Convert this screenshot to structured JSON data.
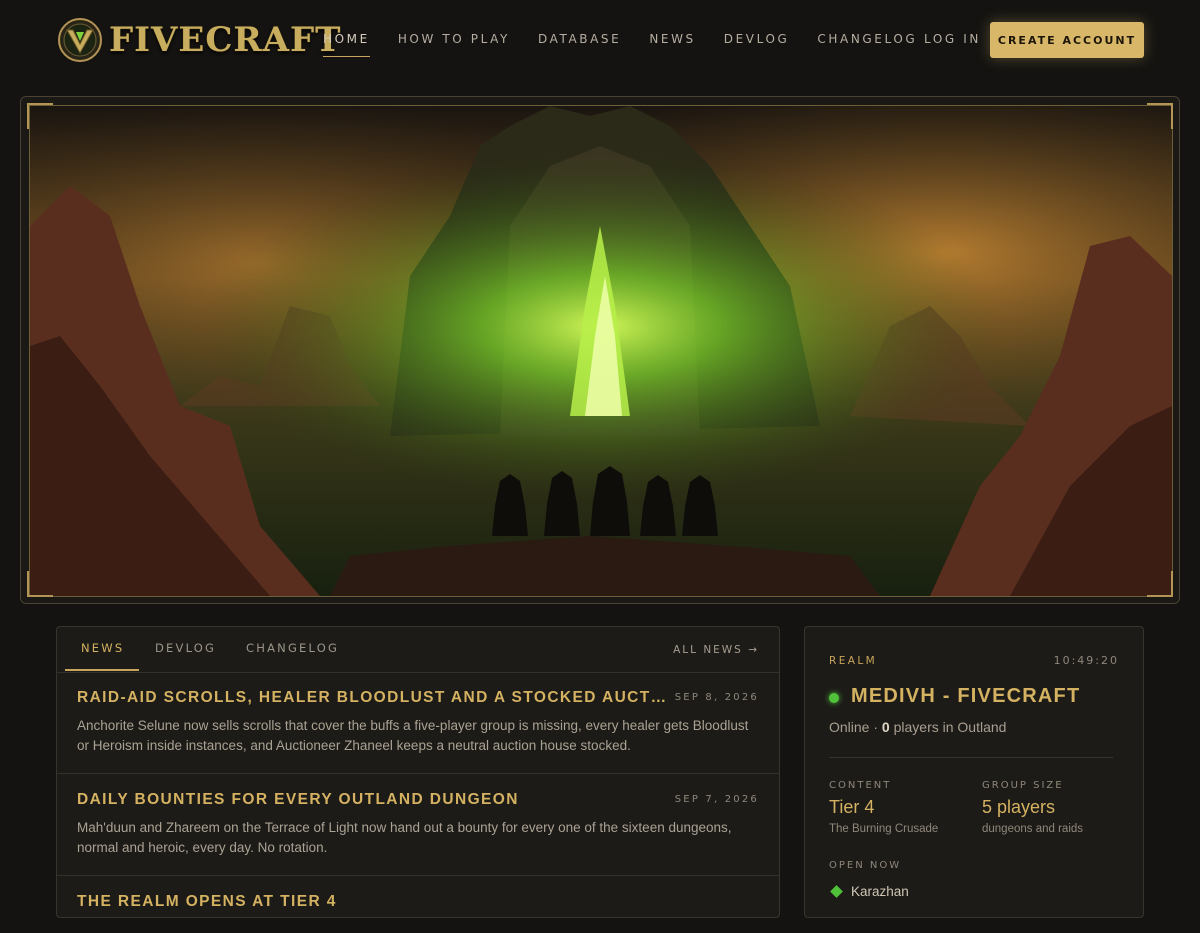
{
  "brand": {
    "name": "FIVECRAFT"
  },
  "nav": {
    "items": [
      {
        "label": "HOME",
        "active": true
      },
      {
        "label": "HOW TO PLAY"
      },
      {
        "label": "DATABASE"
      },
      {
        "label": "NEWS"
      },
      {
        "label": "DEVLOG"
      },
      {
        "label": "CHANGELOG"
      }
    ],
    "login": "LOG IN",
    "create_account": "CREATE ACCOUNT"
  },
  "news": {
    "tabs": [
      {
        "label": "NEWS",
        "active": true
      },
      {
        "label": "DEVLOG"
      },
      {
        "label": "CHANGELOG"
      }
    ],
    "all_news": "ALL NEWS →",
    "articles": [
      {
        "title": "RAID-AID SCROLLS, HEALER BLOODLUST AND A STOCKED AUCTION HOUSE",
        "date": "SEP 8, 2026",
        "body": "Anchorite Selune now sells scrolls that cover the buffs a five-player group is missing, every healer gets Bloodlust or Heroism inside instances, and Auctioneer Zhaneel keeps a neutral auction house stocked."
      },
      {
        "title": "DAILY BOUNTIES FOR EVERY OUTLAND DUNGEON",
        "date": "SEP 7, 2026",
        "body": "Mah'duun and Zhareem on the Terrace of Light now hand out a bounty for every one of the sixteen dungeons, normal and heroic, every day. No rotation."
      },
      {
        "title": "THE REALM OPENS AT TIER 4",
        "date": "",
        "body": ""
      }
    ]
  },
  "realm": {
    "label": "REALM",
    "time": "10:49:20",
    "name": "MEDIVH - FIVECRAFT",
    "status_prefix": "Online · ",
    "players": "0",
    "status_suffix": " players in Outland",
    "status_color": "#4fc23a",
    "content": {
      "label": "CONTENT",
      "value": "Tier 4",
      "sub": "The Burning Crusade"
    },
    "group_size": {
      "label": "GROUP SIZE",
      "value": "5 players",
      "sub": "dungeons and raids"
    },
    "open_now": {
      "label": "OPEN NOW",
      "items": [
        "Karazhan"
      ]
    }
  },
  "colors": {
    "accent": "#d4b261",
    "button": "#d8b868",
    "online": "#4fc23a"
  }
}
